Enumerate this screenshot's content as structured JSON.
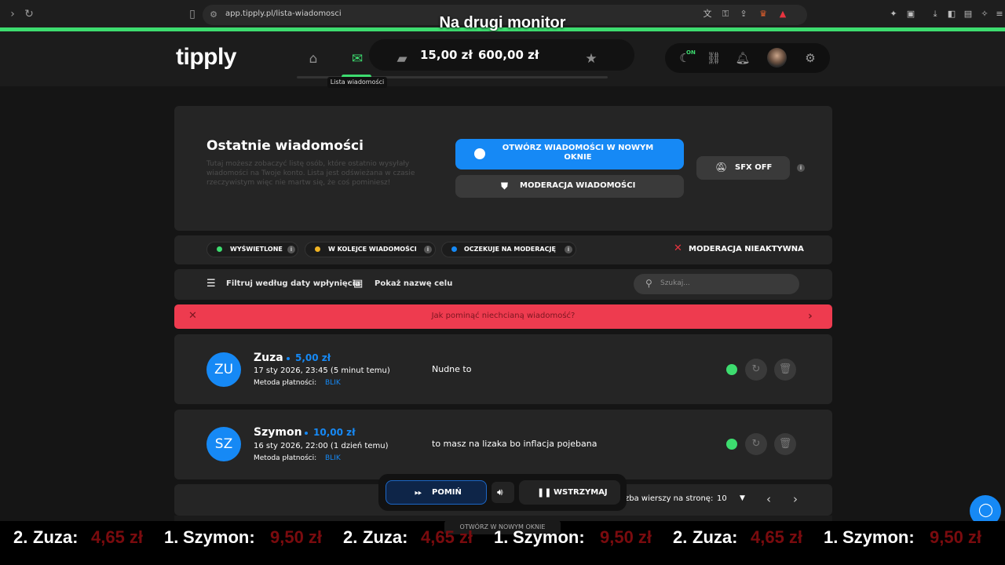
{
  "browser": {
    "url": "app.tipply.pl/lista-wiadomosci"
  },
  "overlay": {
    "title": "Na drugi monitor"
  },
  "app": {
    "logo": "tipply",
    "tooltip": "Lista wiadomości",
    "balance_1": "15,00 zł",
    "balance_2": "600,00 zł",
    "on_label": "ON"
  },
  "header_card": {
    "title": "Ostatnie wiadomości",
    "description": "Tutaj możesz zobaczyć listę osób, które ostatnio wysyłały wiadomości na Twoje konto. Lista jest odświeżana w czasie rzeczywistym więc nie martw się, że coś pominiesz!",
    "open_window_button": "OTWÓRZ WIADOMOŚCI W NOWYM OKNIE",
    "moderation_button": "MODERACJA WIADOMOŚCI",
    "sfx_button": "SFX OFF"
  },
  "legend": {
    "displayed": "WYŚWIETLONE",
    "queued": "W KOLEJCE WIADOMOŚCI",
    "awaiting": "OCZEKUJE NA MODERACJĘ",
    "moderation_status": "MODERACJA NIEAKTYWNA",
    "colors": {
      "displayed": "#3ddc6f",
      "queued": "#f0b323",
      "awaiting": "#1689f5"
    }
  },
  "toolbar": {
    "filter": "Filtruj według daty wpłynięcia",
    "show_goal": "Pokaż nazwę celu",
    "search_placeholder": "Szukaj..."
  },
  "banner": {
    "text": "Jak pominąć niechcianą wiadomość?"
  },
  "messages": [
    {
      "initials": "ZU",
      "name": "Zuza",
      "amount": "5,00 zł",
      "date": "17 sty 2026, 23:45 (5 minut temu)",
      "method_label": "Metoda płatności:",
      "method": "BLIK",
      "text": "Nudne to"
    },
    {
      "initials": "SZ",
      "name": "Szymon",
      "amount": "10,00 zł",
      "date": "16 sty 2026, 22:00 (1 dzień temu)",
      "method_label": "Metoda płatności:",
      "method": "BLIK",
      "text": "to masz na lizaka bo inflacja pojebana"
    }
  ],
  "pagination": {
    "rows_label": "zba wierszy na stronę:",
    "rows_value": "10"
  },
  "player": {
    "skip": "POMIŃ",
    "pause": "WSTRZYMAJ",
    "open_new": "OTWÓRZ W NOWYM OKNIE"
  },
  "ticker": [
    {
      "rank": "2.",
      "name": "Zuza:",
      "amount": "4,65 zł"
    },
    {
      "rank": "1.",
      "name": "Szymon:",
      "amount": "9,50 zł"
    },
    {
      "rank": "2.",
      "name": "Zuza:",
      "amount": "4,65 zł"
    },
    {
      "rank": "1.",
      "name": "Szymon:",
      "amount": "9,50 zł"
    },
    {
      "rank": "2.",
      "name": "Zuza:",
      "amount": "4,65 zł"
    },
    {
      "rank": "1.",
      "name": "Szymon:",
      "amount": "9,50 zł"
    }
  ]
}
